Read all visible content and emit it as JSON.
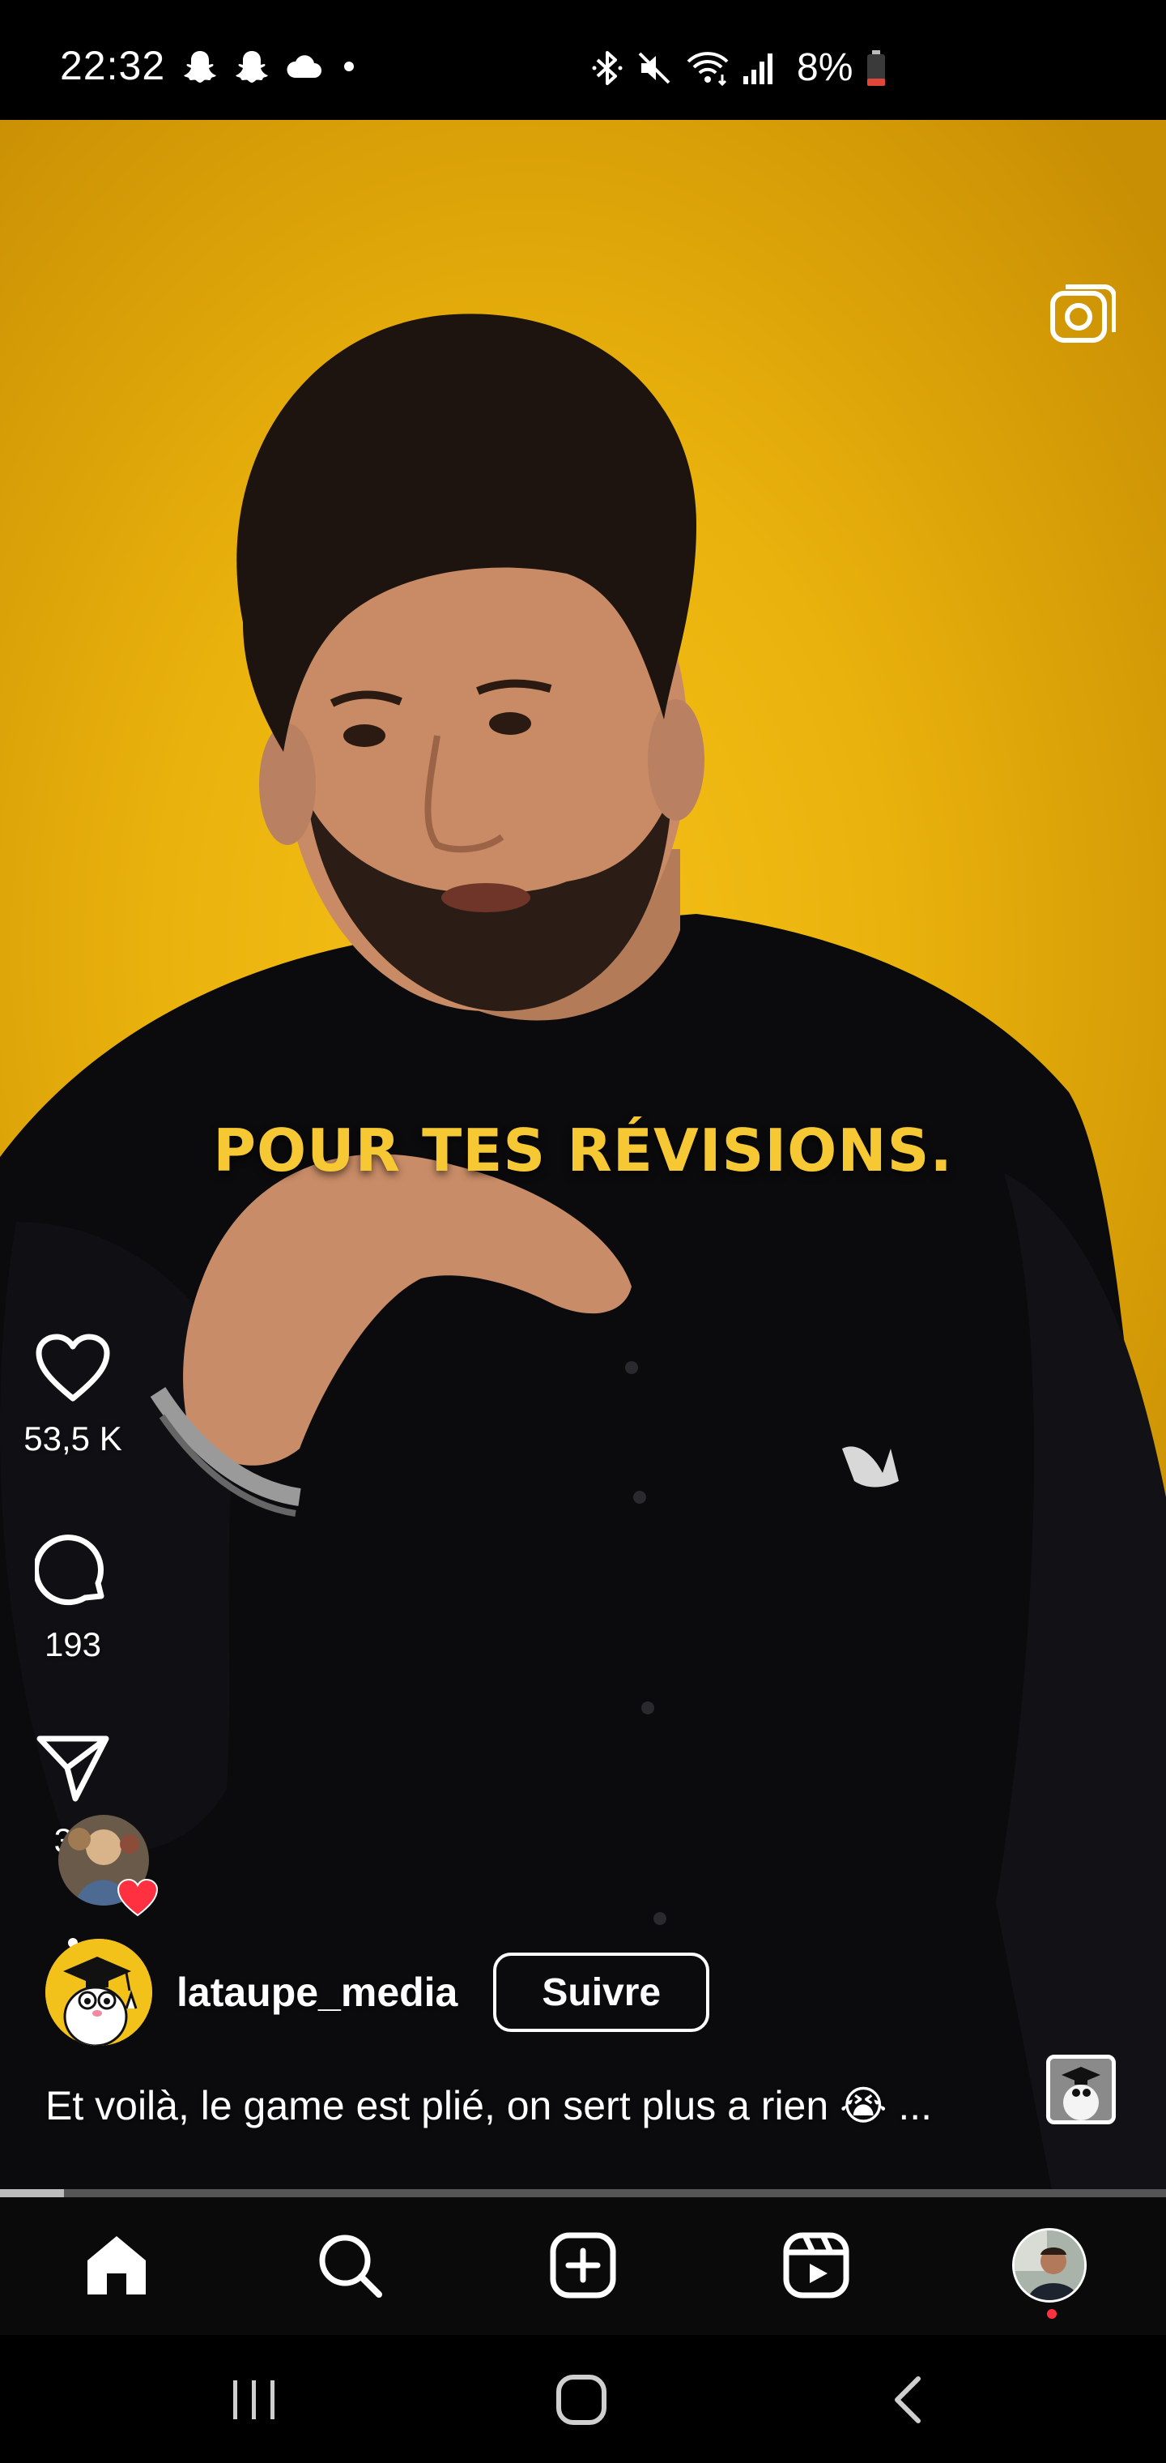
{
  "status_bar": {
    "time": "22:32",
    "notification_icons": [
      "snapchat-icon",
      "snapchat-icon",
      "cloud-icon",
      "dot-icon"
    ],
    "system_icons": [
      "bluetooth-icon",
      "mute-icon",
      "wifi-icon",
      "signal-icon"
    ],
    "battery_text": "8%",
    "battery_color": "#e0463a"
  },
  "video": {
    "overlay_caption": "POUR TES RÉVISIONS.",
    "caption_color": "#f6c934",
    "background_color": "#eab20c"
  },
  "actions": {
    "likes": "53,5 K",
    "comments": "193",
    "shares": "33"
  },
  "post": {
    "author": "lataupe_media",
    "follow_label": "Suivre",
    "caption": "Et voilà, le game est plié, on sert plus a rien 😭 ..."
  },
  "playback": {
    "progress": 0.055
  },
  "nav": {
    "items": [
      "home-icon",
      "search-icon",
      "create-icon",
      "reels-icon",
      "profile"
    ]
  },
  "colors": {
    "like_heart": "#ff3040",
    "notification_dot": "#ff3040"
  }
}
